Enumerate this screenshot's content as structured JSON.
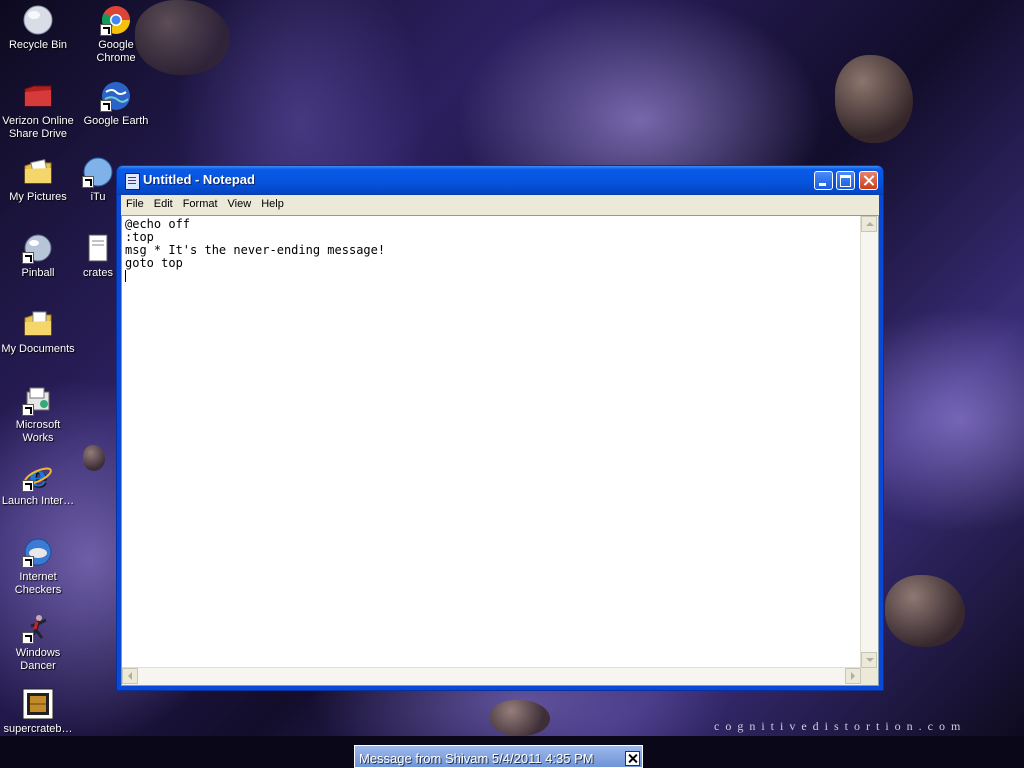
{
  "desktop": {
    "icons": [
      {
        "label": "Recycle Bin",
        "icon": "recycle-bin-icon"
      },
      {
        "label": "Google Chrome",
        "icon": "chrome-icon"
      },
      {
        "label": "Verizon Online Share Drive",
        "icon": "folder-red-icon"
      },
      {
        "label": "Google Earth",
        "icon": "globe-icon"
      },
      {
        "label": "My Pictures",
        "icon": "folder-pictures-icon"
      },
      {
        "label": "iTu",
        "icon": "itunes-icon"
      },
      {
        "label": "Pinball",
        "icon": "pinball-icon"
      },
      {
        "label": "crates",
        "icon": "document-icon"
      },
      {
        "label": "My Documents",
        "icon": "folder-documents-icon"
      },
      {
        "label": "Microsoft Works",
        "icon": "works-icon"
      },
      {
        "label": "Launch Inter…",
        "icon": "internet-explorer-icon"
      },
      {
        "label": "Internet Checkers",
        "icon": "checkers-icon"
      },
      {
        "label": "Windows Dancer",
        "icon": "dancer-icon"
      },
      {
        "label": "supercrateb…",
        "icon": "crate-game-icon"
      }
    ],
    "watermark": "cognitivedistortion.com"
  },
  "notepad": {
    "title": "Untitled - Notepad",
    "menu": [
      "File",
      "Edit",
      "Format",
      "View",
      "Help"
    ],
    "lines": [
      "@echo off",
      ":top",
      "msg * It's the never-ending message!",
      "goto top",
      ""
    ]
  },
  "taskbar": {
    "popup_title": "Message from Shivam 5/4/2011 4:35 PM"
  },
  "colors": {
    "titlebar": "#0655e0",
    "window_frame": "#0a49d6",
    "close_button": "#c8401e"
  }
}
